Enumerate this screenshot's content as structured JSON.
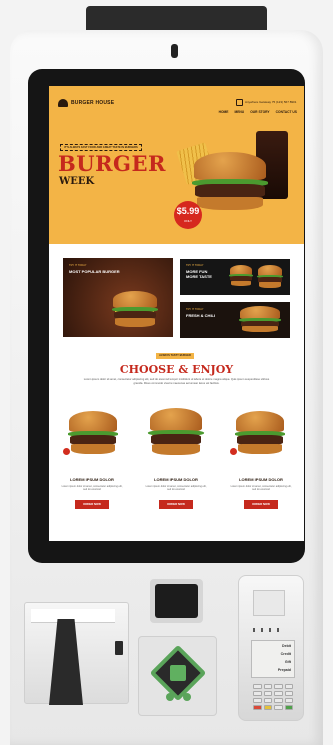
{
  "header": {
    "brand": "BURGER HOUSE",
    "phone": "Anywhere Getaway 75 (123) 567 8901",
    "nav": [
      "HOME",
      "MENU",
      "OUR STORY",
      "CONTACT US"
    ]
  },
  "hero": {
    "tagline": "IT'S ALWAYS FAST FOOD AND GREAT TASTE IN BURGERS",
    "title": "BURGER",
    "subtitle": "WEEK",
    "price": "$5.99",
    "price_note": "ONLY"
  },
  "promos": {
    "big": {
      "kicker": "TRY IT TODAY",
      "title": "MOST POPULAR BURGER"
    },
    "small1": {
      "kicker": "TRY IT TODAY",
      "title_line1": "MORE FUN",
      "title_line2": "MORE TASTE"
    },
    "small2": {
      "kicker": "TRY IT TODAY",
      "title": "FRESH & CHILI"
    }
  },
  "section": {
    "pill": "ALWAYS TASTY BURGER",
    "title": "CHOOSE & ENJOY",
    "intro": "Lorem ipsum dolor sit amet, consectetur adipiscing elit, sed do eiusmod tempor incididunt ut labore et dolore magna aliqua. Quis ipsum suspendisse ultrices gravida. Risus commodo viverra maecenas accumsan lacus vel facilisis."
  },
  "cards": [
    {
      "title": "LOREM IPSUM DOLOR",
      "text": "Lorem ipsum dolor sit amet, consectetur adipiscing elit, sed do eiusmod",
      "button": "ORDER NOW"
    },
    {
      "title": "LOREM IPSUM DOLOR",
      "text": "Lorem ipsum dolor sit amet, consectetur adipiscing elit, sed do eiusmod",
      "button": "ORDER NOW"
    },
    {
      "title": "LOREM IPSUM DOLOR",
      "text": "Lorem ipsum dolor sit amet, consectetur adipiscing elit, sed do eiusmod",
      "button": "ORDER NOW"
    }
  ],
  "terminal": {
    "lines": [
      "Debit",
      "Credit",
      "Gift",
      "Prepaid"
    ]
  },
  "colors": {
    "accent": "#f3b446",
    "brand_red": "#c5291d",
    "qr_green": "#5aa45a"
  }
}
